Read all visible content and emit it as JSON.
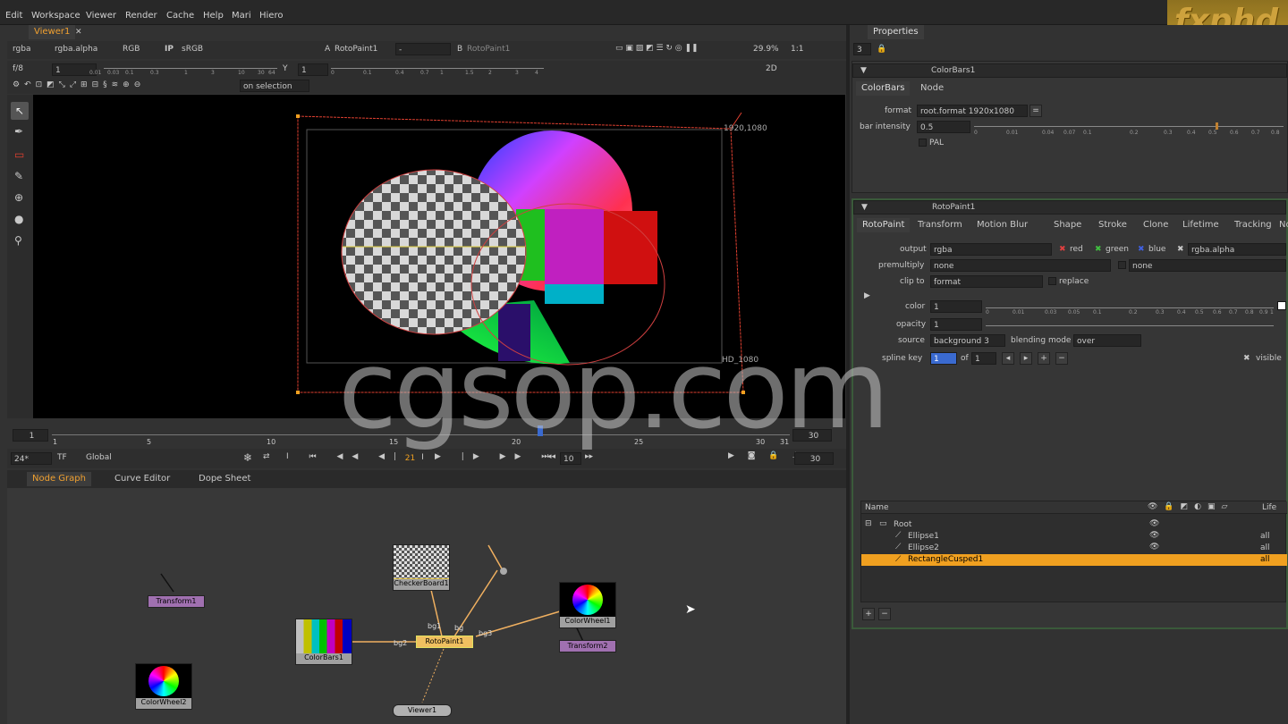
{
  "menu": [
    "Edit",
    "Workspace",
    "Viewer",
    "Render",
    "Cache",
    "Help",
    "Mari",
    "Hiero"
  ],
  "brand": "fxphd",
  "watermark": "cgsop.com",
  "viewer": {
    "tab": "Viewer1",
    "channels": "rgba",
    "alpha": "rgba.alpha",
    "colorspace": "RGB",
    "ip": "IP",
    "lut": "sRGB",
    "input_a": "RotoPaint1",
    "input_a_prefix": "A",
    "dash": "-",
    "input_b": "RotoPaint1",
    "input_b_prefix": "B",
    "zoom": "29.9%",
    "ratio": "1:1",
    "fstop": "f/8",
    "gain": "1",
    "y_label": "Y",
    "gamma": "1",
    "mode": "2D",
    "on_selection": "on selection",
    "res_label_top": "1920,1080",
    "res_label_bottom": "HD_1080",
    "gain_ticks": [
      "0.01",
      "0.03",
      "0.1",
      "0.3",
      "1",
      "3",
      "10",
      "30",
      "64"
    ],
    "gamma_ticks": [
      "0",
      "0.1",
      "0.4",
      "0.7",
      "1",
      "1.5",
      "2",
      "3",
      "4"
    ]
  },
  "timeline": {
    "start": "1",
    "end": "30",
    "labels": [
      "1",
      "5",
      "10",
      "15",
      "20",
      "25",
      "30",
      "31"
    ],
    "fps": "24*",
    "tf": "TF",
    "global": "Global",
    "current_frame": "21",
    "step": "10",
    "end_frame": "30",
    "range_end": "30"
  },
  "bottom_tabs": [
    "Node Graph",
    "Curve Editor",
    "Dope Sheet"
  ],
  "nodes": [
    {
      "name": "Transform1"
    },
    {
      "name": "CheckerBoard1"
    },
    {
      "name": "ColorWheel1"
    },
    {
      "name": "Transform2"
    },
    {
      "name": "ColorBars1"
    },
    {
      "name": "RotoPaint1"
    },
    {
      "name": "ColorWheel2"
    },
    {
      "name": "Viewer1"
    }
  ],
  "edge_labels": {
    "bg1": "bg1",
    "bg": "bg",
    "bg2": "bg2",
    "bg3": "bg3"
  },
  "properties": {
    "title": "Properties",
    "count": "3",
    "colorbars": {
      "name": "ColorBars1",
      "tabs": [
        "ColorBars",
        "Node"
      ],
      "format_label": "format",
      "format_value": "root.format 1920x1080",
      "intensity_label": "bar intensity",
      "intensity_value": "0.5",
      "pal": "PAL",
      "slider_ticks": [
        "0",
        "0.01",
        "0.04",
        "0.07",
        "0.1",
        "0.2",
        "0.3",
        "0.4",
        "0.5",
        "0.6",
        "0.7",
        "0.8"
      ]
    },
    "rotopaint": {
      "name": "RotoPaint1",
      "tabs": [
        "RotoPaint",
        "Transform",
        "Motion Blur",
        "Shape",
        "Stroke",
        "Clone",
        "Lifetime",
        "Tracking",
        "Nod"
      ],
      "output_label": "output",
      "output_value": "rgba",
      "ch_red": "red",
      "ch_green": "green",
      "ch_blue": "blue",
      "ch_alpha": "rgba.alpha",
      "premult_label": "premultiply",
      "premult_value": "none",
      "premult_value2": "none",
      "clip_label": "clip to",
      "clip_value": "format",
      "replace": "replace",
      "color_label": "color",
      "color_value": "1",
      "opacity_label": "opacity",
      "opacity_value": "1",
      "source_label": "source",
      "source_value": "background 3",
      "blend_label": "blending mode",
      "blend_value": "over",
      "spline_label": "spline key",
      "spline_value": "1",
      "spline_of": "of",
      "spline_total": "1",
      "visible": "visible",
      "color_ticks": [
        "0",
        "0.01",
        "0.03",
        "0.05",
        "0.1",
        "0.2",
        "0.3",
        "0.4",
        "0.5",
        "0.6",
        "0.7",
        "0.8",
        "0.9",
        "1"
      ],
      "layers_header": {
        "name": "Name",
        "life": "Life"
      },
      "layers": [
        {
          "name": "Root",
          "life": ""
        },
        {
          "name": "Ellipse1",
          "life": "all"
        },
        {
          "name": "Ellipse2",
          "life": "all"
        },
        {
          "name": "RectangleCusped1",
          "life": "all"
        }
      ]
    }
  },
  "colors": {
    "accent": "#f0a020",
    "selection": "#f0a020",
    "roto_spline": "#e04030"
  }
}
